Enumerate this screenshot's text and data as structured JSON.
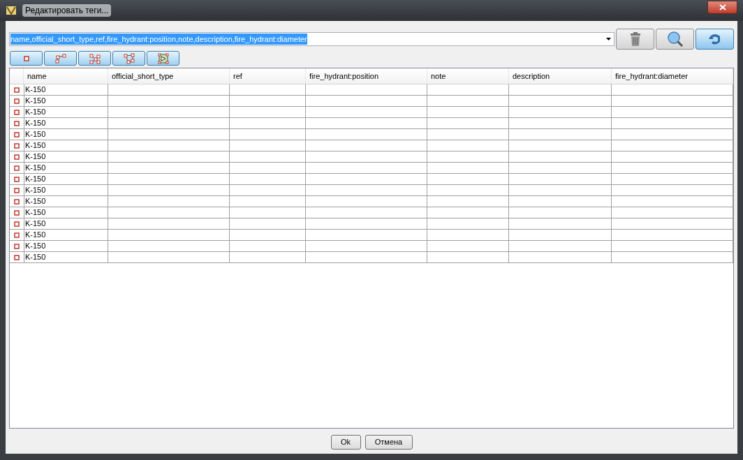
{
  "window": {
    "title": "Редактировать теги..."
  },
  "tag_combo": {
    "value": "name,official_short_type,ref,fire_hydrant:position,note,description,fire_hydrant:diameter"
  },
  "table": {
    "columns": [
      "name",
      "official_short_type",
      "ref",
      "fire_hydrant:position",
      "note",
      "description",
      "fire_hydrant:diameter"
    ],
    "rows": [
      {
        "name": "K-150"
      },
      {
        "name": "K-150"
      },
      {
        "name": "K-150"
      },
      {
        "name": "K-150"
      },
      {
        "name": "K-150"
      },
      {
        "name": "K-150"
      },
      {
        "name": "K-150"
      },
      {
        "name": "K-150"
      },
      {
        "name": "K-150"
      },
      {
        "name": "K-150"
      },
      {
        "name": "K-150"
      },
      {
        "name": "K-150"
      },
      {
        "name": "K-150"
      },
      {
        "name": "K-150"
      },
      {
        "name": "K-150"
      },
      {
        "name": "K-150"
      }
    ]
  },
  "buttons": [
    "Ok",
    "Отмена"
  ]
}
